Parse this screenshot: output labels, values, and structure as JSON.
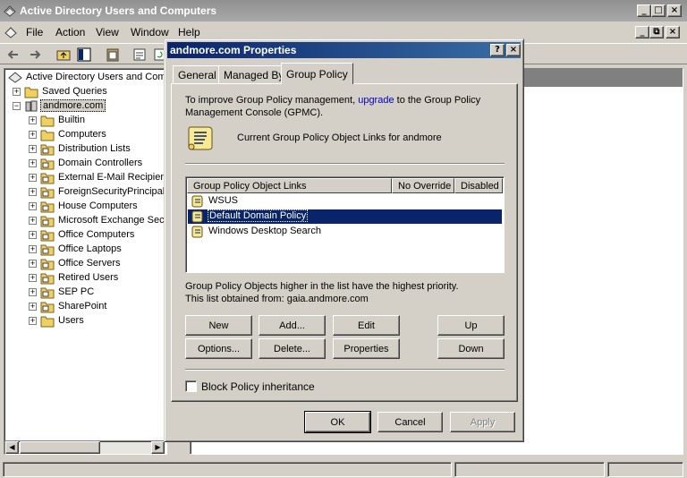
{
  "window": {
    "title": "Active Directory Users and Computers",
    "controls": [
      "_",
      "□",
      "×"
    ]
  },
  "menubar": {
    "items": [
      "File",
      "Action",
      "View",
      "Window",
      "Help"
    ],
    "mdi_controls": [
      "_",
      "⧉",
      "×"
    ]
  },
  "tree": {
    "root": "Active Directory Users and Com",
    "items": [
      {
        "label": "Saved Queries",
        "level": 1
      },
      {
        "label": "andmore.com",
        "level": 1
      },
      {
        "label": "Builtin",
        "level": 2
      },
      {
        "label": "Computers",
        "level": 2
      },
      {
        "label": "Distribution Lists",
        "level": 2
      },
      {
        "label": "Domain Controllers",
        "level": 2
      },
      {
        "label": "External E-Mail Recipien",
        "level": 2
      },
      {
        "label": "ForeignSecurityPrincipal",
        "level": 2
      },
      {
        "label": "House Computers",
        "level": 2
      },
      {
        "label": "Microsoft Exchange Sec",
        "level": 2
      },
      {
        "label": "Office Computers",
        "level": 2
      },
      {
        "label": "Office Laptops",
        "level": 2
      },
      {
        "label": "Office Servers",
        "level": 2
      },
      {
        "label": "Retired Users",
        "level": 2
      },
      {
        "label": "SEP PC",
        "level": 2
      },
      {
        "label": "SharePoint",
        "level": 2
      },
      {
        "label": "Users",
        "level": 2
      }
    ]
  },
  "dialog": {
    "title": "andmore.com Properties",
    "title_buttons": [
      "?",
      "×"
    ],
    "tabs": [
      "General",
      "Managed By",
      "Group Policy"
    ],
    "active_tab": "Group Policy",
    "intro_pre": "To improve Group Policy management, ",
    "intro_link": "upgrade",
    "intro_post": " to the Group Policy",
    "intro_line2": "Management Console (GPMC).",
    "current_links_label": "Current Group Policy Object Links for andmore",
    "list": {
      "columns": [
        "Group Policy Object Links",
        "No Override",
        "Disabled"
      ],
      "rows": [
        {
          "name": "WSUS",
          "selected": false
        },
        {
          "name": "Default Domain Policy",
          "selected": true
        },
        {
          "name": "Windows Desktop Search",
          "selected": false
        }
      ]
    },
    "priority_note": "Group Policy Objects higher in the list have the highest priority.",
    "obtained_from": "This list obtained from: gaia.andmore.com",
    "buttons": {
      "new": "New",
      "add": "Add...",
      "edit": "Edit",
      "up": "Up",
      "options": "Options...",
      "delete": "Delete...",
      "properties": "Properties",
      "down": "Down"
    },
    "block_inheritance": {
      "label": "Block Policy inheritance",
      "checked": false
    },
    "footer": {
      "ok": "OK",
      "cancel": "Cancel",
      "apply": "Apply"
    }
  },
  "colors": {
    "dialog_title_start": "#0a246a",
    "dialog_title_end": "#3a6ea5",
    "selection": "#0a246a",
    "link": "#0000cc",
    "chrome": "#d4d0c8"
  }
}
